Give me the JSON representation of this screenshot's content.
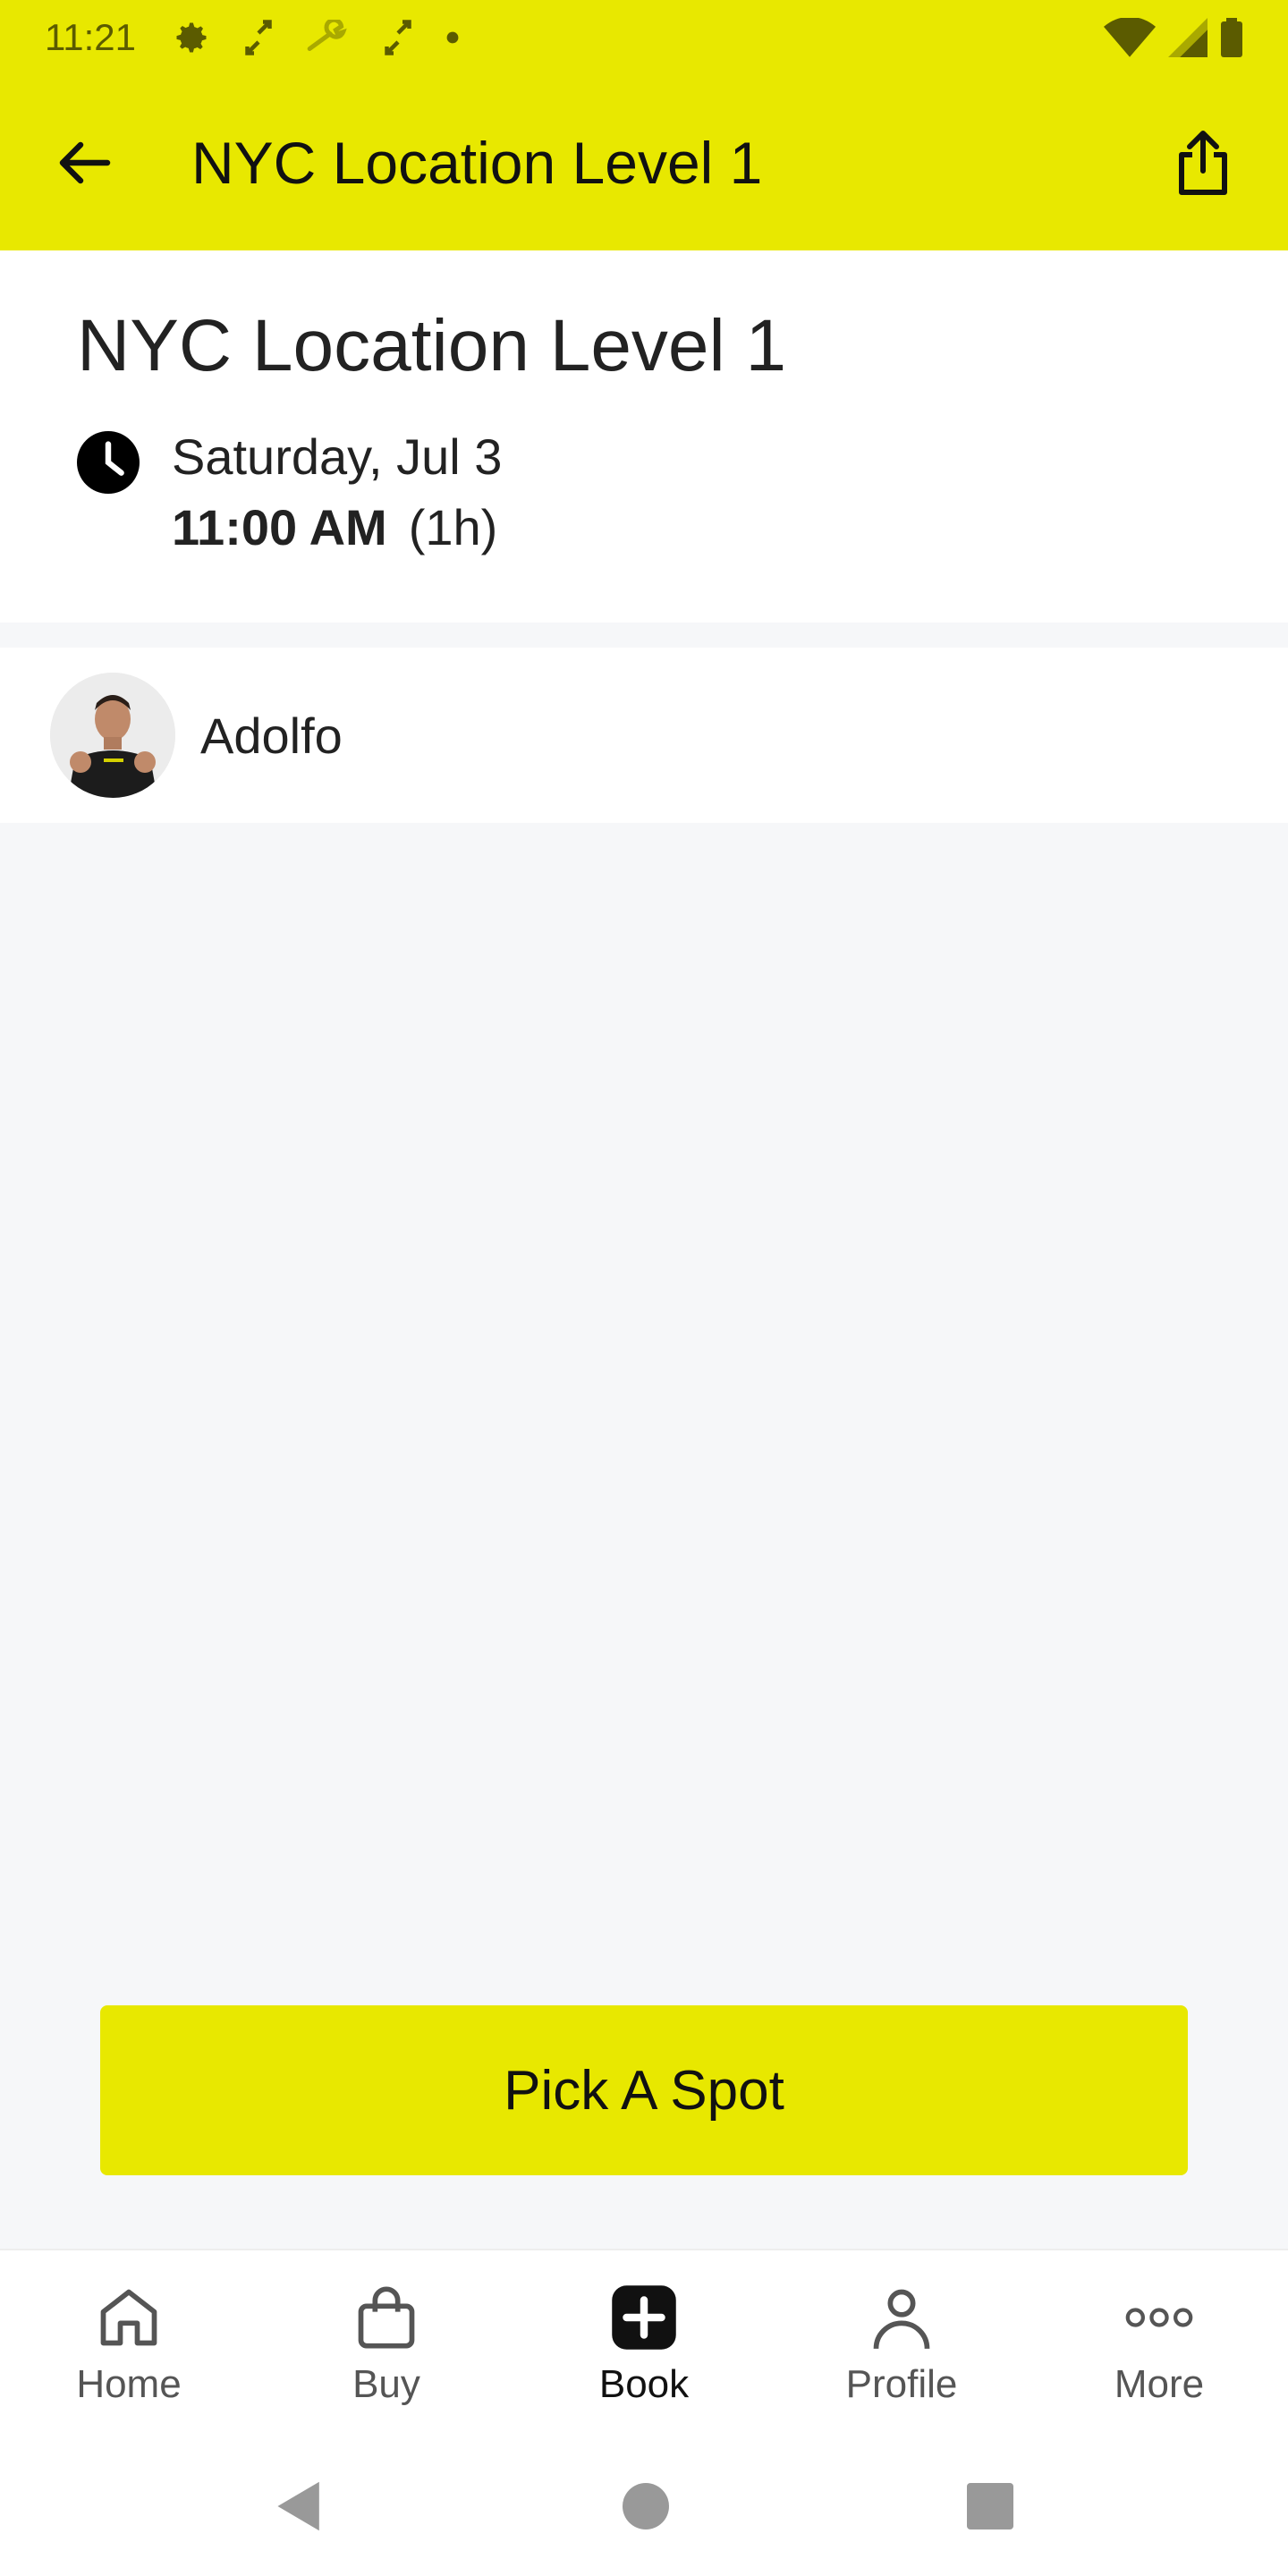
{
  "status_bar": {
    "time": "11:21",
    "icons_left": [
      "gear-icon",
      "expand-arrows-icon",
      "wrench-icon",
      "expand-arrows-icon",
      "dot-icon"
    ],
    "icons_right": [
      "wifi-icon",
      "signal-icon",
      "battery-icon"
    ]
  },
  "app_bar": {
    "title": "NYC Location Level 1",
    "back_icon": "arrow-left-icon",
    "share_icon": "share-icon"
  },
  "event": {
    "title": "NYC Location Level 1",
    "date": "Saturday, Jul 3",
    "time": "11:00 AM",
    "duration": "(1h)"
  },
  "instructor": {
    "name": "Adolfo"
  },
  "cta": {
    "label": "Pick A Spot"
  },
  "bottom_nav": {
    "items": [
      {
        "label": "Home",
        "icon": "home-icon"
      },
      {
        "label": "Buy",
        "icon": "shopping-bag-icon"
      },
      {
        "label": "Book",
        "icon": "plus-square-icon"
      },
      {
        "label": "Profile",
        "icon": "user-icon"
      },
      {
        "label": "More",
        "icon": "more-dots-icon"
      }
    ],
    "active": "Book"
  },
  "colors": {
    "brand_yellow": "#e8e800",
    "background": "#f6f7f9",
    "text": "#222222"
  }
}
